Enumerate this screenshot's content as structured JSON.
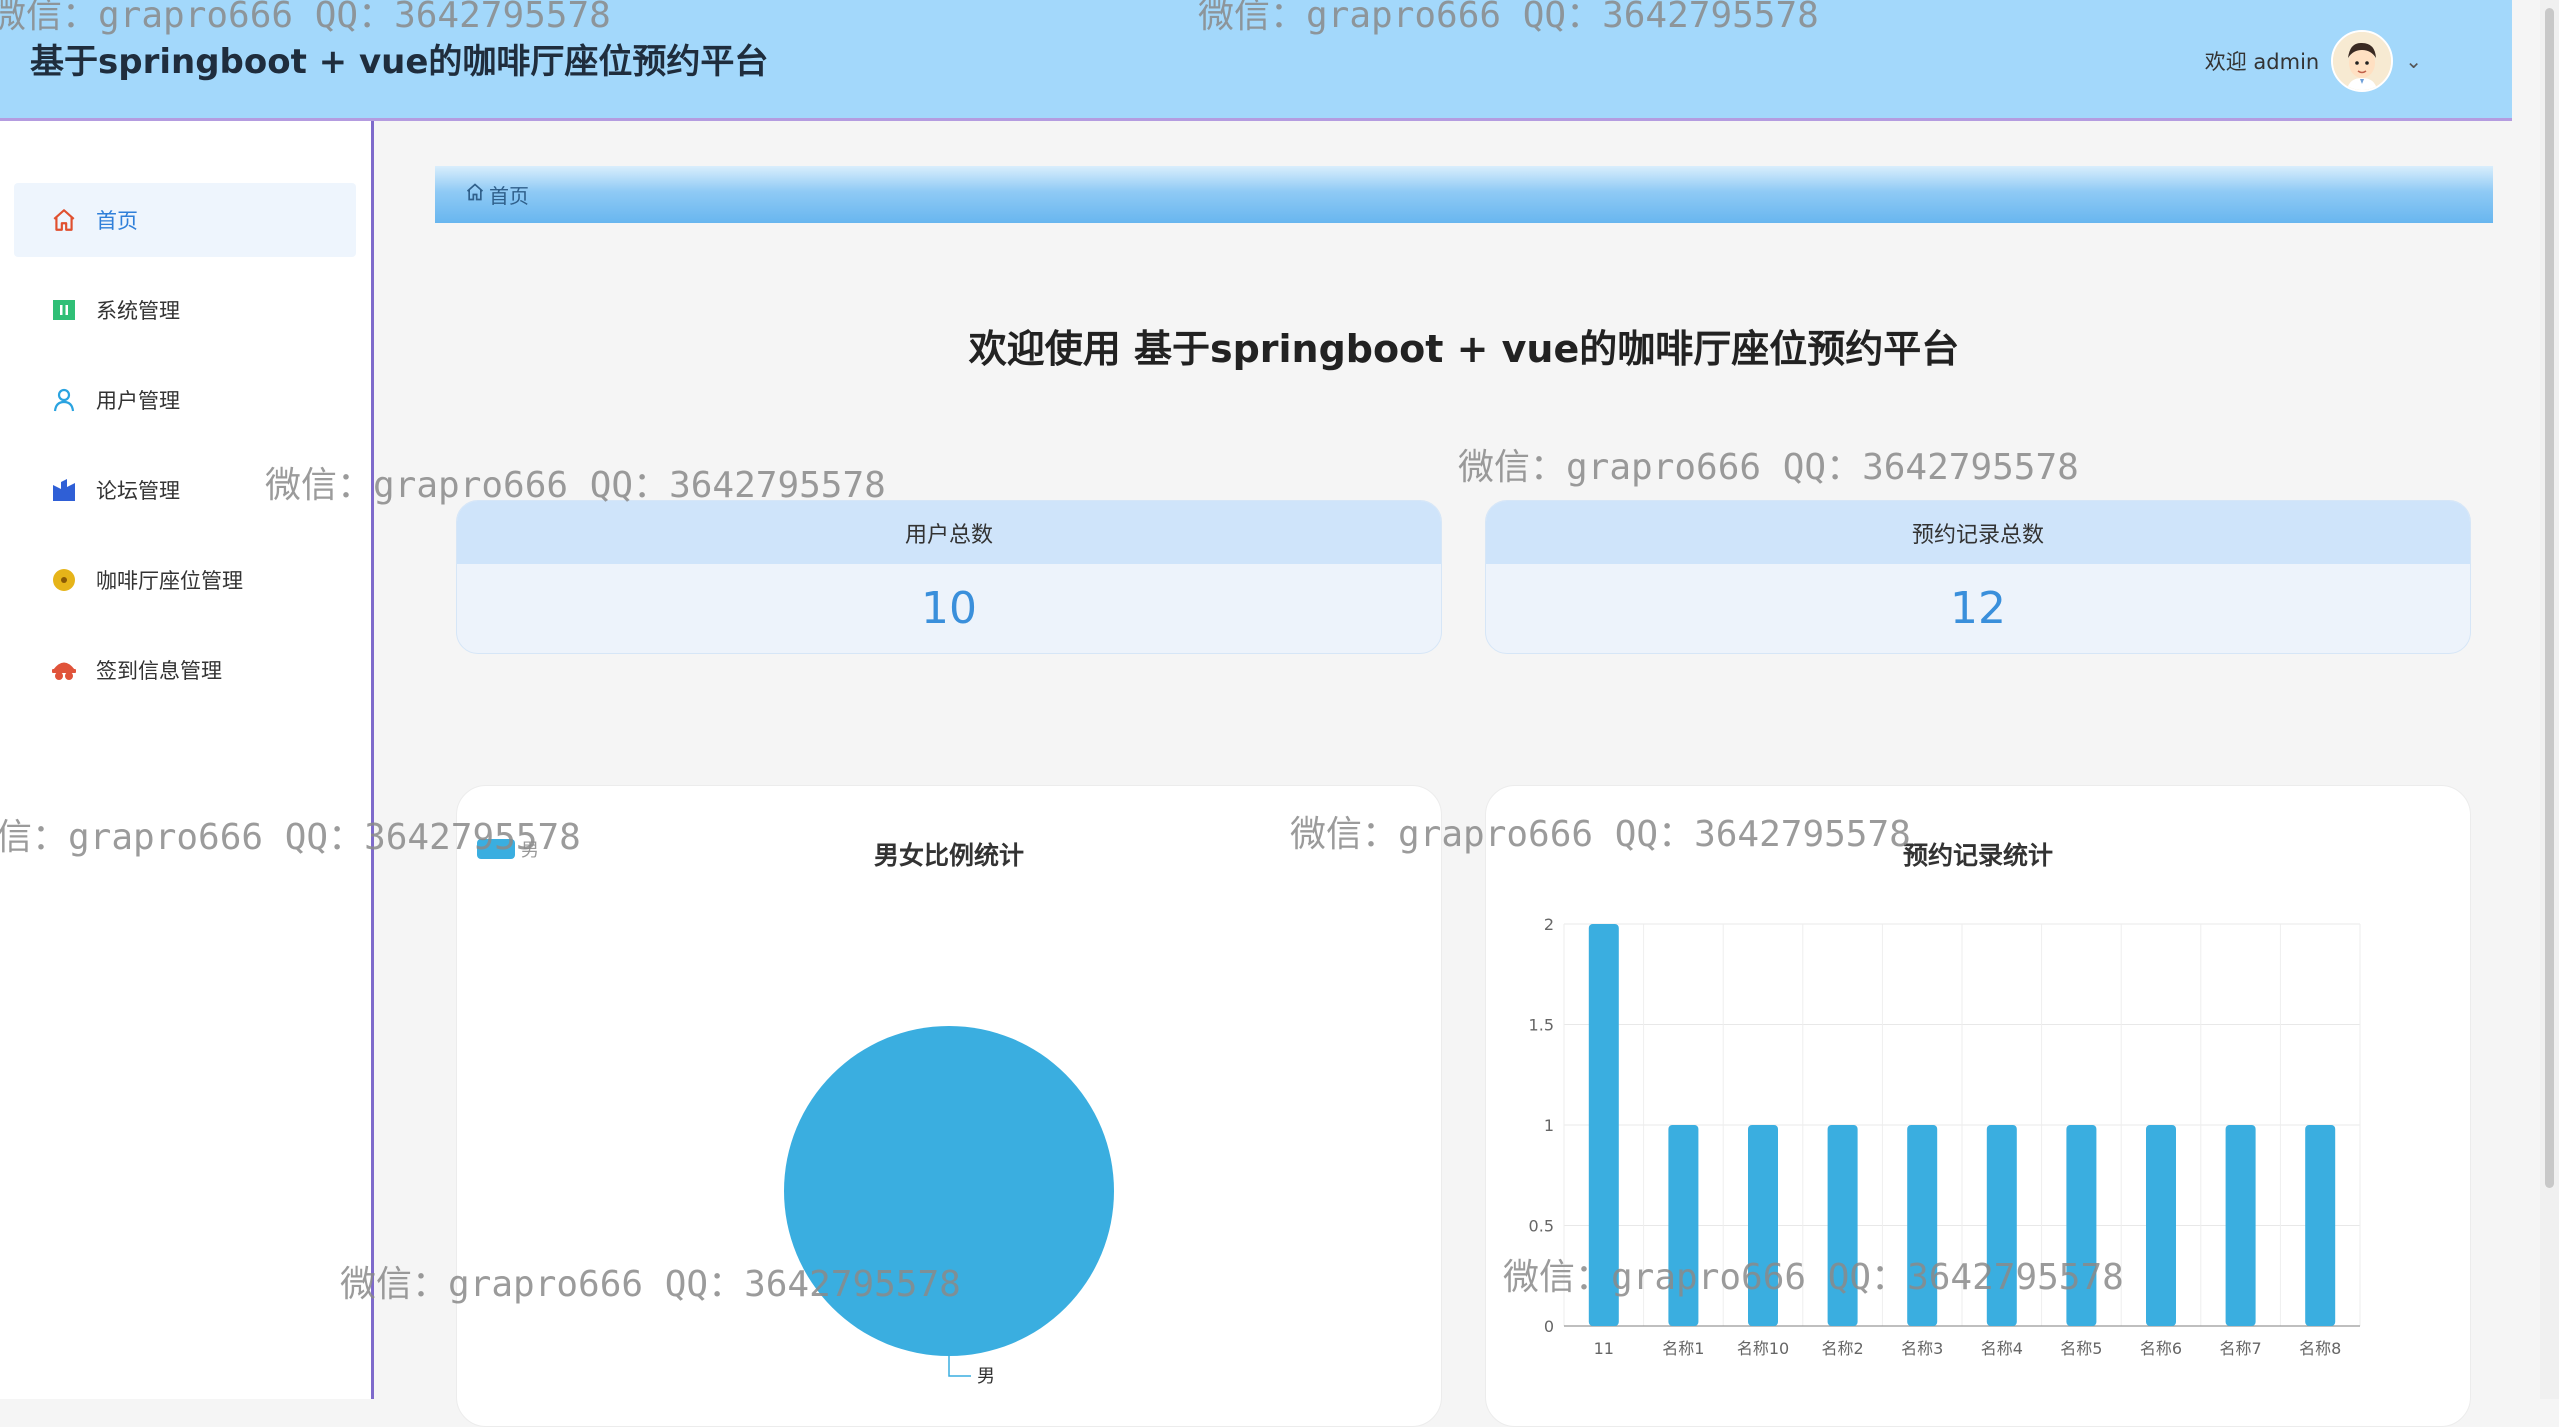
{
  "header": {
    "title": "基于springboot + vue的咖啡厅座位预约平台",
    "welcome": "欢迎 admin"
  },
  "sidebar": {
    "items": [
      {
        "label": "首页",
        "icon": "home-icon",
        "active": true
      },
      {
        "label": "系统管理",
        "icon": "system-icon",
        "active": false
      },
      {
        "label": "用户管理",
        "icon": "user-icon",
        "active": false
      },
      {
        "label": "论坛管理",
        "icon": "forum-icon",
        "active": false
      },
      {
        "label": "咖啡厅座位管理",
        "icon": "coffee-seat-icon",
        "active": false
      },
      {
        "label": "签到信息管理",
        "icon": "checkin-icon",
        "active": false
      }
    ]
  },
  "breadcrumb": {
    "label": "首页"
  },
  "main": {
    "welcome_title": "欢迎使用 基于springboot + vue的咖啡厅座位预约平台",
    "stats": [
      {
        "label": "用户总数",
        "value": "10"
      },
      {
        "label": "预约记录总数",
        "value": "12"
      }
    ]
  },
  "colors": {
    "header_bg": "#a3d8fb",
    "accent": "#3a8fdb",
    "chart": "#3aaee0"
  },
  "watermark": "微信：grapro666 QQ：3642795578",
  "chart_data": [
    {
      "type": "pie",
      "title": "男女比例统计",
      "legend": [
        "男"
      ],
      "slices": [
        {
          "name": "男",
          "value": 100
        }
      ]
    },
    {
      "type": "bar",
      "title": "预约记录统计",
      "categories": [
        "11",
        "名称1",
        "名称10",
        "名称2",
        "名称3",
        "名称4",
        "名称5",
        "名称6",
        "名称7",
        "名称8"
      ],
      "values": [
        2,
        1,
        1,
        1,
        1,
        1,
        1,
        1,
        1,
        1
      ],
      "ylim": [
        0,
        2
      ],
      "yticks": [
        "0",
        "0.5",
        "1",
        "1.5",
        "2"
      ],
      "grid": true
    }
  ]
}
